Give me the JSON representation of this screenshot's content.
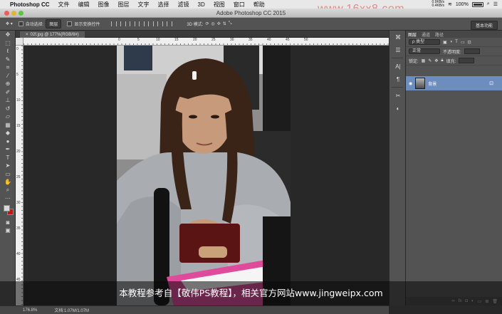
{
  "menubar": {
    "app_name": "Photoshop CC",
    "items": [
      "文件",
      "编辑",
      "图像",
      "图层",
      "文字",
      "选择",
      "滤镜",
      "3D",
      "视图",
      "窗口",
      "帮助"
    ],
    "net_up": "0.9KB/s",
    "net_down": "0.4KB/s",
    "battery": "100%",
    "watermark": "www.16xx8.com"
  },
  "window": {
    "title": "Adobe Photoshop CC 2015"
  },
  "options_bar": {
    "auto_select_label": "自动选择:",
    "auto_select_value": "图层",
    "show_transform_label": "显示变换控件",
    "mode_3d_label": "3D 模式:",
    "workspace": "基本功能"
  },
  "document": {
    "tab_title": "02f.jpg @ 177%(RGB/8#)",
    "ruler_h_labels": [
      "0",
      "5",
      "10",
      "15",
      "20",
      "25",
      "30",
      "35",
      "40",
      "45",
      "50"
    ],
    "ruler_v_labels": [
      "0",
      "5",
      "10",
      "15",
      "20",
      "25",
      "30",
      "35",
      "40",
      "45"
    ]
  },
  "layers_panel": {
    "tabs": [
      "图层",
      "通道",
      "路径"
    ],
    "filter_kind": "ρ 类型",
    "blend_mode": "正常",
    "opacity_label": "不透明度:",
    "lock_label": "锁定:",
    "fill_label": "填充:",
    "layer_name": "背景"
  },
  "status": {
    "zoom": "176.8%",
    "doc_size": "文档:1.07M/1.07M"
  },
  "subtitle": "本教程参考自【敬伟PS教程】，相关官方网站www.jingweipx.com",
  "colors": {
    "foreground": "#d8d8d8",
    "background": "#cc1111",
    "selected_layer": "#6d8dbf"
  }
}
